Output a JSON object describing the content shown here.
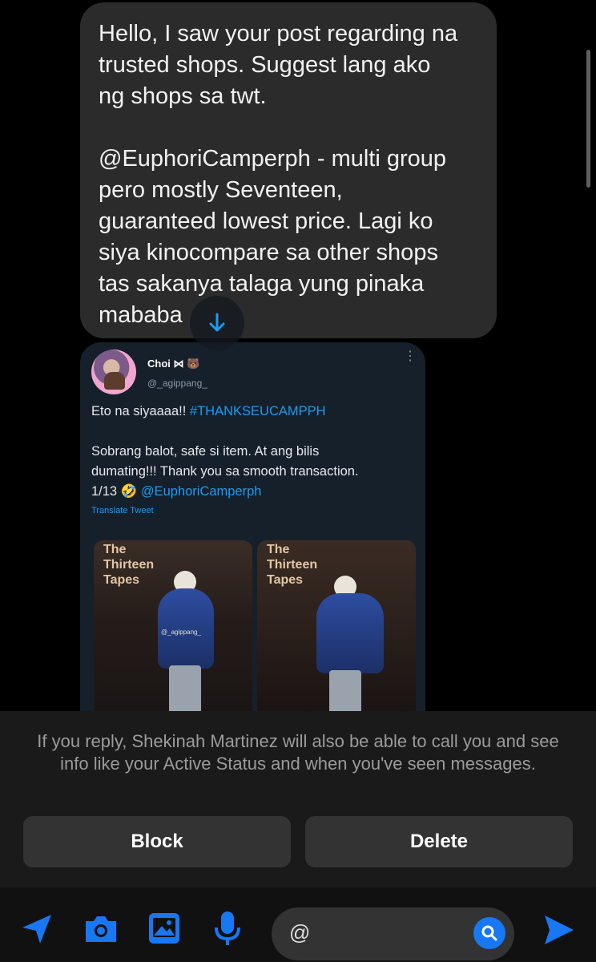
{
  "message": {
    "paragraph1": [
      "Hello, I saw your post regarding na",
      "trusted shops. Suggest lang ako",
      "ng shops sa twt."
    ],
    "paragraph2": [
      "@EuphoriCamperph - multi group",
      "pero mostly Seventeen,",
      "guaranteed lowest price. Lagi ko",
      "siya kinocompare sa other shops",
      "tas sakanya talaga yung pinaka",
      "mababa"
    ]
  },
  "tweet": {
    "name": "Choi ⋈ 🐻",
    "handle": "@_agippang_",
    "line1_text": "Eto na siyaaaa!! ",
    "line1_hashtag": "#THANKSEUCAMPPH",
    "line2": "Sobrang balot, safe si item. At ang bilis",
    "line3": "dumating!!! Thank you sa smooth transaction.",
    "line4_text": "1/13 🤣 ",
    "line4_mention": "@EuphoriCamperph",
    "translate": "Translate Tweet",
    "photo_label": [
      "The",
      "Thirteen",
      "Tapes"
    ],
    "watermark": "@_agippang_"
  },
  "notice": {
    "text": "If you reply, Shekinah Martinez will also be able to call you and see info like your Active Status and when you've seen messages."
  },
  "actions": {
    "block": "Block",
    "delete": "Delete"
  },
  "composer": {
    "input_prefix": "@",
    "icons": [
      "send-arrow-icon",
      "camera-icon",
      "image-icon",
      "microphone-icon",
      "search-icon",
      "send-icon"
    ]
  },
  "colors": {
    "accent": "#1877f2",
    "twitter_blue": "#1d9bf0",
    "bubble": "#2b2b2b"
  }
}
